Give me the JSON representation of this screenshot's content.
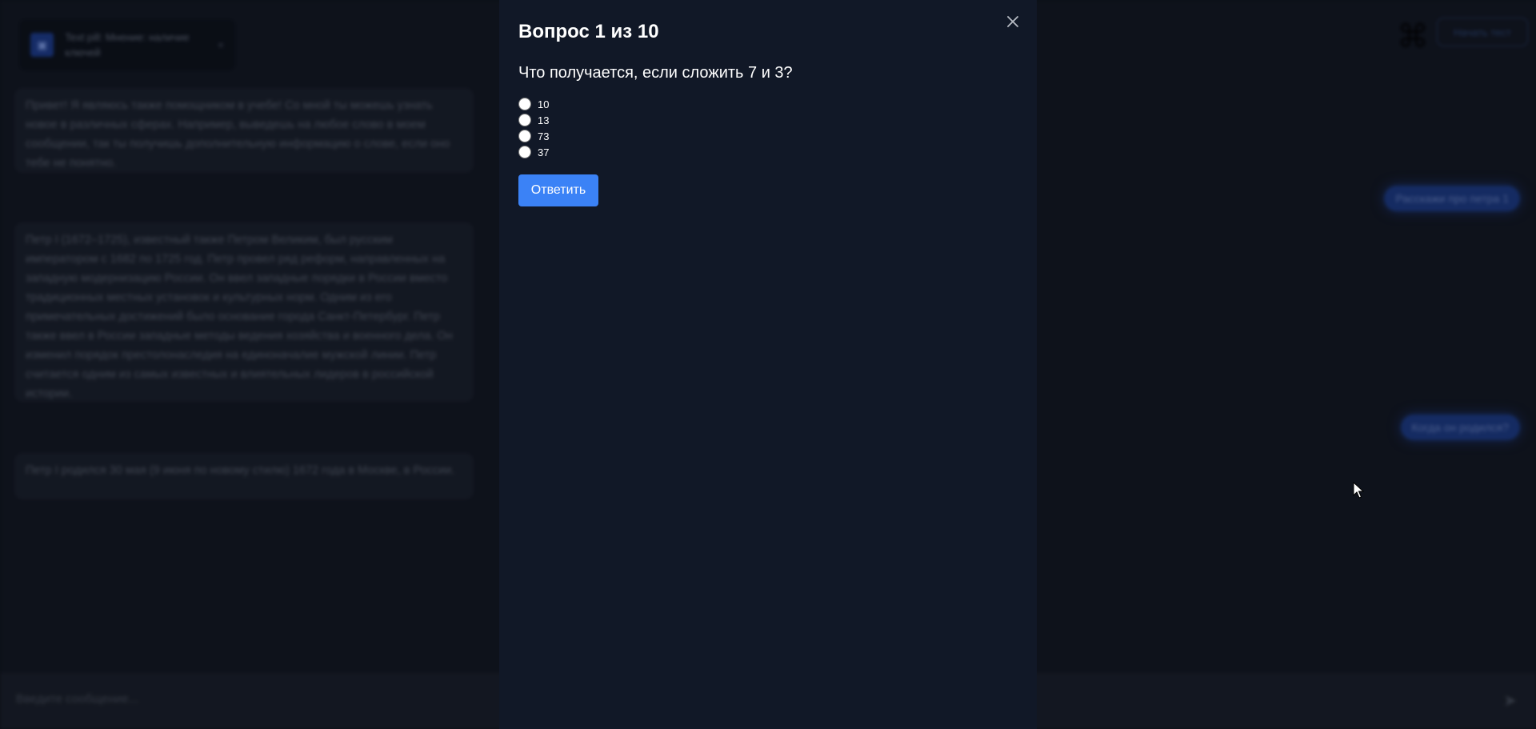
{
  "background": {
    "context_pill": {
      "icon": "context-icon",
      "text": "Text pill: Мнение: наличие ключей",
      "close_glyph": "×"
    },
    "messages": [
      {
        "role": "bot",
        "text": "Привет! Я являюсь также помощником в учебе! Со мной ты можешь узнать новое в различных сферах. Например, выведешь на любое слово в моем сообщении, так ты получишь дополнительную информацию о слове, если оно тебе не понятно."
      },
      {
        "role": "user",
        "text": "Расскажи про петра 1"
      },
      {
        "role": "bot",
        "text": "Петр I (1672–1725), известный также Петром Великим, был русским императором с 1682 по 1725 год. Петр провел ряд реформ, направленных на западную модернизацию России. Он ввел западные порядки в России вместо традиционных местных установок и культурных норм. Одним из его примечательных достижений было основание города Санкт-Петербург. Петр также ввел в России западные методы ведения хозяйства и военного дела. Он изменил порядок престолонаследия на единоначалие мужской линии. Петр считается одним из самых известных и влиятельных лидеров в российской истории."
      },
      {
        "role": "user",
        "text": "Когда он родился?"
      },
      {
        "role": "bot",
        "text": "Петр I родился 30 мая (9 июня по новому стилю) 1672 года в Москве, в России."
      }
    ],
    "top_right_button": "Начать тест",
    "input_placeholder": "Введите сообщение..."
  },
  "quiz": {
    "title": "Вопрос 1 из 10",
    "question": "Что получается, если сложить 7 и 3?",
    "options": [
      "10",
      "13",
      "73",
      "37"
    ],
    "selected": null,
    "submit_label": "Ответить"
  },
  "colors": {
    "accent": "#3b82f6",
    "modal_bg": "#111827",
    "page_bg": "#111722"
  }
}
